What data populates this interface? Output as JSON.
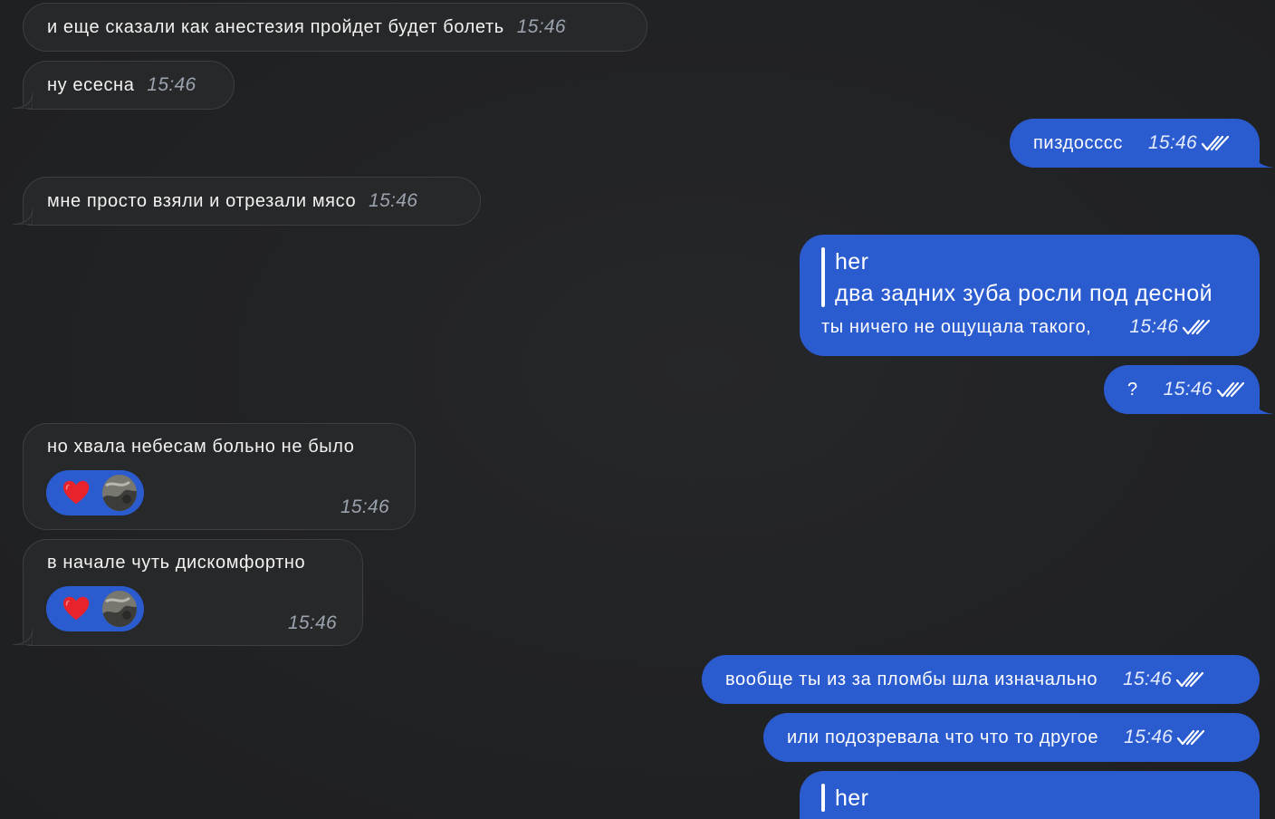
{
  "messages": [
    {
      "id": "m1",
      "direction": "incoming",
      "text": "и еще сказали как анестезия пройдет будет болеть",
      "time": "15:46"
    },
    {
      "id": "m2",
      "direction": "incoming",
      "text": "ну есесна",
      "time": "15:46"
    },
    {
      "id": "m3",
      "direction": "outgoing",
      "text": "пиздосссс",
      "time": "15:46",
      "status": "read"
    },
    {
      "id": "m4",
      "direction": "incoming",
      "text": "мне просто взяли и отрезали мясо",
      "time": "15:46"
    },
    {
      "id": "m5",
      "direction": "outgoing",
      "reply": {
        "author": "her",
        "text": "два задних зуба росли под десной"
      },
      "text": "ты ничего не ощущала такого,",
      "time": "15:46",
      "status": "read"
    },
    {
      "id": "m6",
      "direction": "outgoing",
      "text": "?",
      "time": "15:46",
      "status": "read"
    },
    {
      "id": "m7",
      "direction": "incoming",
      "text": "но хвала небесам больно не было",
      "time": "15:46",
      "reaction": {
        "emoji": "heart-icon"
      }
    },
    {
      "id": "m8",
      "direction": "incoming",
      "text": "в начале чуть дискомфортно",
      "time": "15:46",
      "reaction": {
        "emoji": "heart-icon"
      }
    },
    {
      "id": "m9",
      "direction": "outgoing",
      "text": "вообще ты из за пломбы шла изначально",
      "time": "15:46",
      "status": "read"
    },
    {
      "id": "m10",
      "direction": "outgoing",
      "text": "или подозревала что что то другое",
      "time": "15:46",
      "status": "read"
    },
    {
      "id": "m11",
      "direction": "outgoing",
      "reply": {
        "author": "her"
      }
    }
  ],
  "colors": {
    "background": "#212224",
    "incoming_bubble": "#272829",
    "incoming_border": "#3d3e40",
    "outgoing_bubble": "#2a5bcf",
    "timestamp_incoming": "#9aa2ae",
    "heart": "#e8232b"
  }
}
